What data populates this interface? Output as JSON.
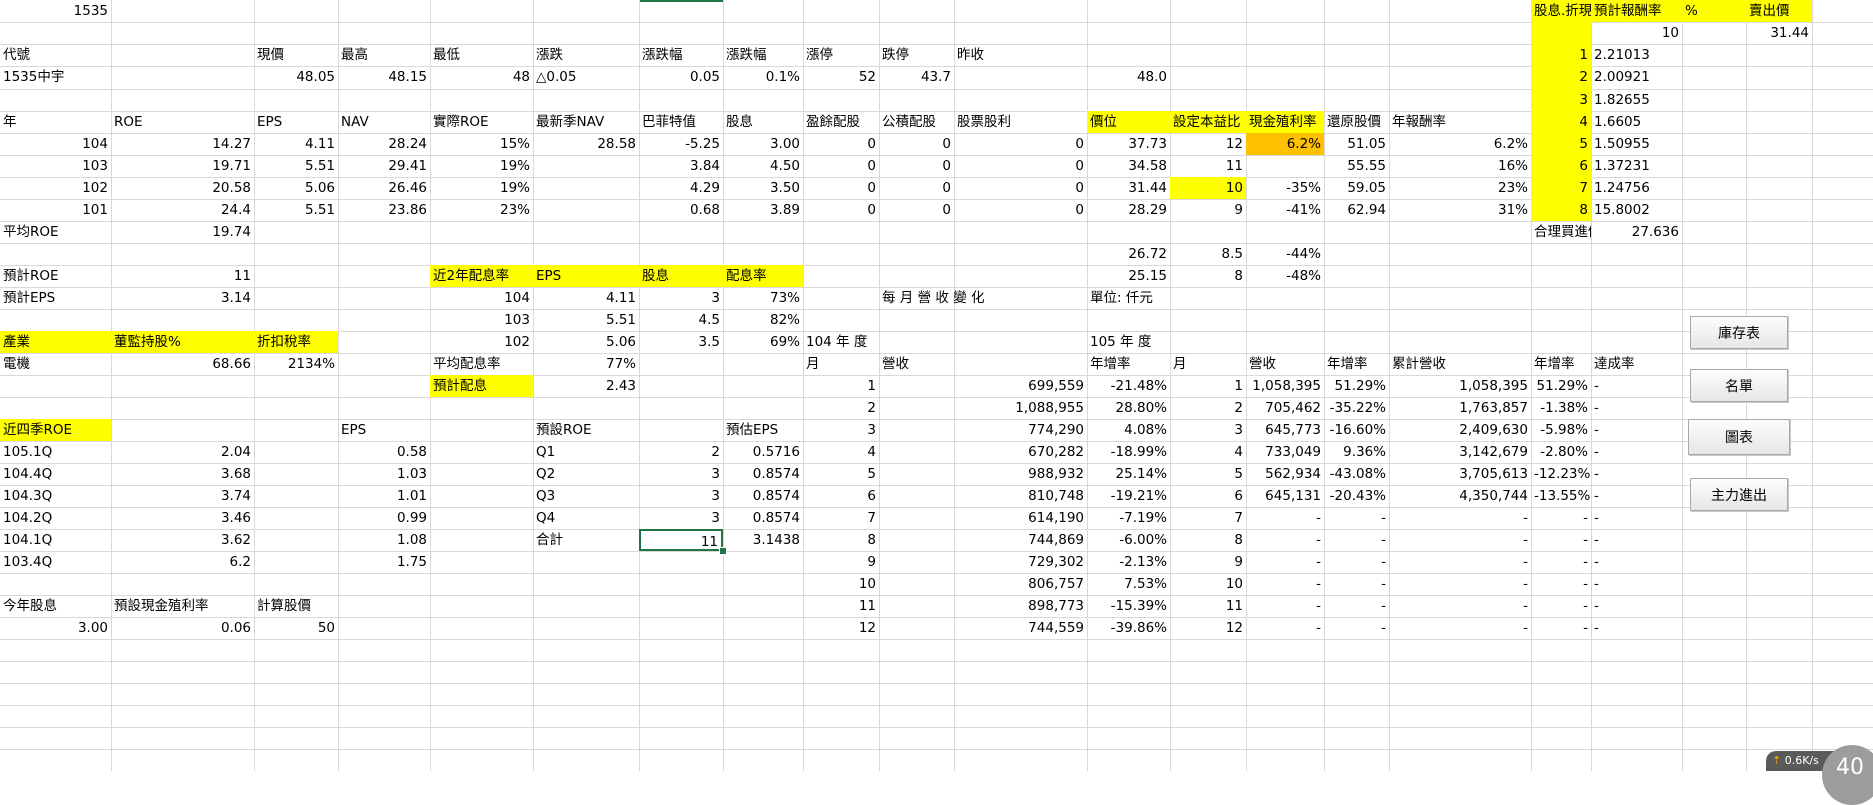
{
  "sheet": {
    "cells": {
      "r1": [
        "1535",
        "股息.折現",
        "預計報酬率",
        "%",
        "賣出價"
      ],
      "r2": [
        "10",
        "31.44"
      ],
      "hdr_quote": [
        "代號",
        "現價",
        "最高",
        "最低",
        "漲跌",
        "漲跌幅",
        "漲跌幅",
        "漲停",
        "跌停",
        "昨收"
      ],
      "quote": [
        "1535中宇",
        "48.05",
        "48.15",
        "48",
        "△0.05",
        "0.05",
        "0.1%",
        "52",
        "43.7",
        "48.0"
      ],
      "hdr_main": [
        "年",
        "ROE",
        "EPS",
        "NAV",
        "實際ROE",
        "最新季NAV",
        "巴菲特值",
        "股息",
        "盈餘配股",
        "公積配股",
        "股票股利",
        "價位",
        "設定本益比",
        "現金殖利率",
        "還原股價",
        "年報酬率"
      ],
      "years": [
        [
          "104",
          "14.27",
          "4.11",
          "28.24",
          "15%",
          "28.58",
          "-5.25",
          "3.00",
          "0",
          "0",
          "0",
          "37.73",
          "12",
          "6.2%",
          "51.05",
          "6.2%"
        ],
        [
          "103",
          "19.71",
          "5.51",
          "29.41",
          "19%",
          "",
          "3.84",
          "4.50",
          "0",
          "0",
          "0",
          "34.58",
          "11",
          "",
          "55.55",
          "16%"
        ],
        [
          "102",
          "20.58",
          "5.06",
          "26.46",
          "19%",
          "",
          "4.29",
          "3.50",
          "0",
          "0",
          "0",
          "31.44",
          "10",
          "-35%",
          "59.05",
          "23%"
        ],
        [
          "101",
          "24.4",
          "5.51",
          "23.86",
          "23%",
          "",
          "0.68",
          "3.89",
          "0",
          "0",
          "0",
          "28.29",
          "9",
          "-41%",
          "62.94",
          "31%"
        ]
      ],
      "avg_roe": [
        "平均ROE",
        "19.74"
      ],
      "extra_price": [
        [
          "26.72",
          "8.5",
          "-44%"
        ],
        [
          "25.15",
          "8",
          "-48%"
        ]
      ],
      "discount": [
        [
          "1",
          "2.21013"
        ],
        [
          "2",
          "2.00921"
        ],
        [
          "3",
          "1.82655"
        ],
        [
          "4",
          "1.6605"
        ],
        [
          "5",
          "1.50955"
        ],
        [
          "6",
          "1.37231"
        ],
        [
          "7",
          "1.24756"
        ],
        [
          "8",
          "15.8002"
        ]
      ],
      "fair_price": [
        "合理買進價",
        "27.636"
      ],
      "est": [
        [
          "預計ROE",
          "11"
        ],
        [
          "預計EPS",
          "3.14"
        ]
      ],
      "payout_hdr": [
        "近2年配息率",
        "EPS",
        "股息",
        "配息率"
      ],
      "payout": [
        [
          "104",
          "4.11",
          "3",
          "73%"
        ],
        [
          "103",
          "5.51",
          "4.5",
          "82%"
        ],
        [
          "102",
          "5.06",
          "3.5",
          "69%"
        ]
      ],
      "payout_avg": [
        "平均配息率",
        "77%"
      ],
      "payout_est": [
        "預計配息",
        "2.43"
      ],
      "industry_hdr": [
        "產業",
        "董監持股%",
        "折扣稅率"
      ],
      "industry": [
        "電機",
        "68.66",
        "2134%"
      ],
      "monthly_title": [
        "每 月 營 收 變 化",
        "單位: 仟元"
      ],
      "y104_title": "104 年 度",
      "y105_title": "105 年 度",
      "m104_hdr": [
        "月",
        "營收",
        "年增率"
      ],
      "m105_hdr": [
        "月",
        "營收",
        "年增率",
        "累計營收",
        "年增率",
        "達成率"
      ],
      "m104": [
        [
          "1",
          "699,559",
          "-21.48%"
        ],
        [
          "2",
          "1,088,955",
          "28.80%"
        ],
        [
          "3",
          "774,290",
          "4.08%"
        ],
        [
          "4",
          "670,282",
          "-18.99%"
        ],
        [
          "5",
          "988,932",
          "25.14%"
        ],
        [
          "6",
          "810,748",
          "-19.21%"
        ],
        [
          "7",
          "614,190",
          "-7.19%"
        ],
        [
          "8",
          "744,869",
          "-6.00%"
        ],
        [
          "9",
          "729,302",
          "-2.13%"
        ],
        [
          "10",
          "806,757",
          "7.53%"
        ],
        [
          "11",
          "898,773",
          "-15.39%"
        ],
        [
          "12",
          "744,559",
          "-39.86%"
        ]
      ],
      "m105": [
        [
          "1",
          "1,058,395",
          "51.29%",
          "1,058,395",
          "51.29%",
          "-"
        ],
        [
          "2",
          "705,462",
          "-35.22%",
          "1,763,857",
          "-1.38%",
          "-"
        ],
        [
          "3",
          "645,773",
          "-16.60%",
          "2,409,630",
          "-5.98%",
          "-"
        ],
        [
          "4",
          "733,049",
          "9.36%",
          "3,142,679",
          "-2.80%",
          "-"
        ],
        [
          "5",
          "562,934",
          "-43.08%",
          "3,705,613",
          "-12.23%",
          "-"
        ],
        [
          "6",
          "645,131",
          "-20.43%",
          "4,350,744",
          "-13.55%",
          "-"
        ],
        [
          "7",
          "-",
          "-",
          "-",
          "-",
          "-"
        ],
        [
          "8",
          "-",
          "-",
          "-",
          "-",
          "-"
        ],
        [
          "9",
          "-",
          "-",
          "-",
          "-",
          "-"
        ],
        [
          "10",
          "-",
          "-",
          "-",
          "-",
          "-"
        ],
        [
          "11",
          "-",
          "-",
          "-",
          "-",
          "-"
        ],
        [
          "12",
          "-",
          "-",
          "-",
          "-",
          "-"
        ]
      ],
      "q_hdr": [
        "近四季ROE",
        "EPS",
        "預設ROE",
        "預估EPS"
      ],
      "quarters": [
        [
          "105.1Q",
          "2.04",
          "0.58"
        ],
        [
          "104.4Q",
          "3.68",
          "1.03"
        ],
        [
          "104.3Q",
          "3.74",
          "1.01"
        ],
        [
          "104.2Q",
          "3.46",
          "0.99"
        ],
        [
          "104.1Q",
          "3.62",
          "1.08"
        ],
        [
          "103.4Q",
          "6.2",
          "1.75"
        ]
      ],
      "q_est": [
        [
          "Q1",
          "2",
          "0.5716"
        ],
        [
          "Q2",
          "3",
          "0.8574"
        ],
        [
          "Q3",
          "3",
          "0.8574"
        ],
        [
          "Q4",
          "3",
          "0.8574"
        ],
        [
          "合計",
          "11",
          "3.1438"
        ]
      ],
      "div_hdr": [
        "今年股息",
        "預設現金殖利率",
        "計算股價"
      ],
      "div": [
        "3.00",
        "0.06",
        "50"
      ]
    }
  },
  "buttons": {
    "inventory": "庫存表",
    "list": "名單",
    "chart": "圖表",
    "main_force": "主力進出"
  },
  "status": {
    "net_speed": "0.6",
    "net_unit": "K/s",
    "badge": "40"
  },
  "colors": {
    "highlight": "#ffff00",
    "orange": "#ffc000",
    "grid": "#d9d9d9",
    "select": "#217346"
  }
}
